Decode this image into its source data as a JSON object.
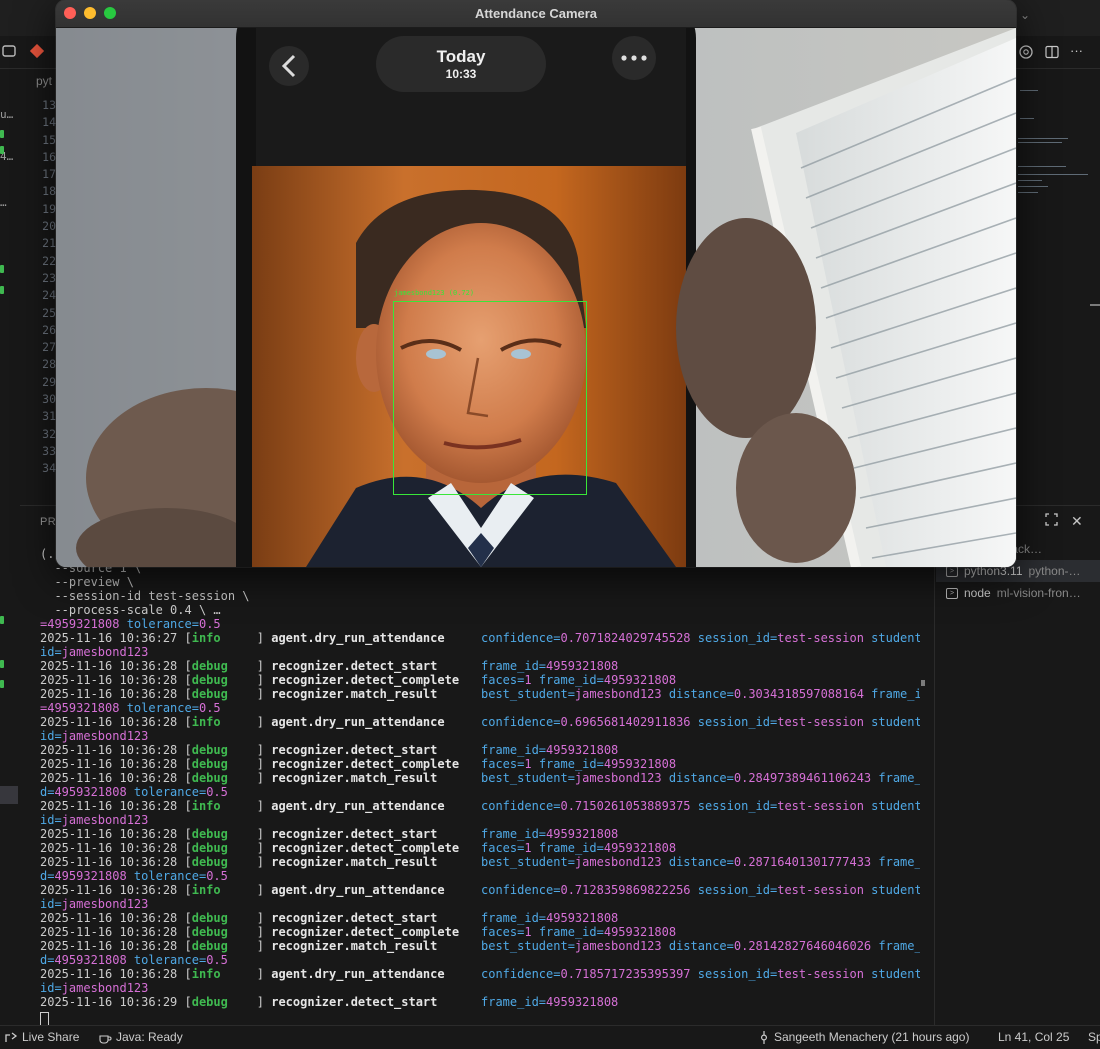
{
  "ide": {
    "editor_tab_label": "pyt",
    "line_numbers": [
      "13",
      "14",
      "15",
      "16",
      "17",
      "18",
      "19",
      "20",
      "21",
      "22",
      "23",
      "24",
      "25",
      "26",
      "27",
      "28",
      "29",
      "30",
      "31",
      "32",
      "33",
      "34"
    ],
    "panel_tab_label": "PR"
  },
  "camera_window": {
    "title": "Attendance Camera",
    "phone": {
      "header_title": "Today",
      "header_time": "10:33"
    },
    "detection": {
      "label": "jamesbond123 (0.72)",
      "box_color": "#39e639"
    }
  },
  "terminal": {
    "command_lines": [
      "(.",
      "  --source 1 \\",
      "  --preview \\",
      "  --session-id test-session \\",
      "  --process-scale 0.4 \\ …"
    ],
    "log_lines": [
      {
        "type": "wrap",
        "parts": [
          {
            "k": "",
            "v": "=4959321808"
          },
          {
            "k": " tolerance=",
            "v": "0.5"
          }
        ]
      },
      {
        "type": "log",
        "ts": "2025-11-16 10:36:27",
        "level": "info",
        "event": "agent.dry_run_attendance",
        "fields": [
          {
            "k": "confidence=",
            "v": "0.7071824029745528"
          },
          {
            "k": " session_id=",
            "v": "test-session"
          },
          {
            "k": " student_",
            "v": ""
          }
        ]
      },
      {
        "type": "wrap",
        "parts": [
          {
            "k": "id=",
            "v": "jamesbond123"
          }
        ]
      },
      {
        "type": "log",
        "ts": "2025-11-16 10:36:28",
        "level": "debug",
        "event": "recognizer.detect_start",
        "fields": [
          {
            "k": "frame_id=",
            "v": "4959321808"
          }
        ]
      },
      {
        "type": "log",
        "ts": "2025-11-16 10:36:28",
        "level": "debug",
        "event": "recognizer.detect_complete",
        "fields": [
          {
            "k": "faces=",
            "v": "1"
          },
          {
            "k": " frame_id=",
            "v": "4959321808"
          }
        ]
      },
      {
        "type": "log",
        "ts": "2025-11-16 10:36:28",
        "level": "debug",
        "event": "recognizer.match_result",
        "fields": [
          {
            "k": "best_student=",
            "v": "jamesbond123"
          },
          {
            "k": " distance=",
            "v": "0.3034318597088164"
          },
          {
            "k": " frame_id",
            "v": ""
          }
        ]
      },
      {
        "type": "wrap",
        "parts": [
          {
            "k": "",
            "v": "=4959321808"
          },
          {
            "k": " tolerance=",
            "v": "0.5"
          }
        ]
      },
      {
        "type": "log",
        "ts": "2025-11-16 10:36:28",
        "level": "info",
        "event": "agent.dry_run_attendance",
        "fields": [
          {
            "k": "confidence=",
            "v": "0.6965681402911836"
          },
          {
            "k": " session_id=",
            "v": "test-session"
          },
          {
            "k": " student_",
            "v": ""
          }
        ]
      },
      {
        "type": "wrap",
        "parts": [
          {
            "k": "id=",
            "v": "jamesbond123"
          }
        ]
      },
      {
        "type": "log",
        "ts": "2025-11-16 10:36:28",
        "level": "debug",
        "event": "recognizer.detect_start",
        "fields": [
          {
            "k": "frame_id=",
            "v": "4959321808"
          }
        ]
      },
      {
        "type": "log",
        "ts": "2025-11-16 10:36:28",
        "level": "debug",
        "event": "recognizer.detect_complete",
        "fields": [
          {
            "k": "faces=",
            "v": "1"
          },
          {
            "k": " frame_id=",
            "v": "4959321808"
          }
        ]
      },
      {
        "type": "log",
        "ts": "2025-11-16 10:36:28",
        "level": "debug",
        "event": "recognizer.match_result",
        "fields": [
          {
            "k": "best_student=",
            "v": "jamesbond123"
          },
          {
            "k": " distance=",
            "v": "0.28497389461106243"
          },
          {
            "k": " frame_i",
            "v": ""
          }
        ]
      },
      {
        "type": "wrap",
        "parts": [
          {
            "k": "d=",
            "v": "4959321808"
          },
          {
            "k": " tolerance=",
            "v": "0.5"
          }
        ]
      },
      {
        "type": "log",
        "ts": "2025-11-16 10:36:28",
        "level": "info",
        "event": "agent.dry_run_attendance",
        "fields": [
          {
            "k": "confidence=",
            "v": "0.7150261053889375"
          },
          {
            "k": " session_id=",
            "v": "test-session"
          },
          {
            "k": " student_",
            "v": ""
          }
        ]
      },
      {
        "type": "wrap",
        "parts": [
          {
            "k": "id=",
            "v": "jamesbond123"
          }
        ]
      },
      {
        "type": "log",
        "ts": "2025-11-16 10:36:28",
        "level": "debug",
        "event": "recognizer.detect_start",
        "fields": [
          {
            "k": "frame_id=",
            "v": "4959321808"
          }
        ]
      },
      {
        "type": "log",
        "ts": "2025-11-16 10:36:28",
        "level": "debug",
        "event": "recognizer.detect_complete",
        "fields": [
          {
            "k": "faces=",
            "v": "1"
          },
          {
            "k": " frame_id=",
            "v": "4959321808"
          }
        ]
      },
      {
        "type": "log",
        "ts": "2025-11-16 10:36:28",
        "level": "debug",
        "event": "recognizer.match_result",
        "fields": [
          {
            "k": "best_student=",
            "v": "jamesbond123"
          },
          {
            "k": " distance=",
            "v": "0.28716401301777433"
          },
          {
            "k": " frame_i",
            "v": ""
          }
        ]
      },
      {
        "type": "wrap",
        "parts": [
          {
            "k": "d=",
            "v": "4959321808"
          },
          {
            "k": " tolerance=",
            "v": "0.5"
          }
        ]
      },
      {
        "type": "log",
        "ts": "2025-11-16 10:36:28",
        "level": "info",
        "event": "agent.dry_run_attendance",
        "fields": [
          {
            "k": "confidence=",
            "v": "0.7128359869822256"
          },
          {
            "k": " session_id=",
            "v": "test-session"
          },
          {
            "k": " student_",
            "v": ""
          }
        ]
      },
      {
        "type": "wrap",
        "parts": [
          {
            "k": "id=",
            "v": "jamesbond123"
          }
        ]
      },
      {
        "type": "log",
        "ts": "2025-11-16 10:36:28",
        "level": "debug",
        "event": "recognizer.detect_start",
        "fields": [
          {
            "k": "frame_id=",
            "v": "4959321808"
          }
        ]
      },
      {
        "type": "log",
        "ts": "2025-11-16 10:36:28",
        "level": "debug",
        "event": "recognizer.detect_complete",
        "fields": [
          {
            "k": "faces=",
            "v": "1"
          },
          {
            "k": " frame_id=",
            "v": "4959321808"
          }
        ]
      },
      {
        "type": "log",
        "ts": "2025-11-16 10:36:28",
        "level": "debug",
        "event": "recognizer.match_result",
        "fields": [
          {
            "k": "best_student=",
            "v": "jamesbond123"
          },
          {
            "k": " distance=",
            "v": "0.28142827646046026"
          },
          {
            "k": " frame_i",
            "v": ""
          }
        ]
      },
      {
        "type": "wrap",
        "parts": [
          {
            "k": "d=",
            "v": "4959321808"
          },
          {
            "k": " tolerance=",
            "v": "0.5"
          }
        ]
      },
      {
        "type": "log",
        "ts": "2025-11-16 10:36:28",
        "level": "info",
        "event": "agent.dry_run_attendance",
        "fields": [
          {
            "k": "confidence=",
            "v": "0.7185717235395397"
          },
          {
            "k": " session_id=",
            "v": "test-session"
          },
          {
            "k": " student_",
            "v": ""
          }
        ]
      },
      {
        "type": "wrap",
        "parts": [
          {
            "k": "id=",
            "v": "jamesbond123"
          }
        ]
      },
      {
        "type": "log",
        "ts": "2025-11-16 10:36:29",
        "level": "debug",
        "event": "recognizer.detect_start",
        "fields": [
          {
            "k": "frame_id=",
            "v": "4959321808"
          }
        ]
      }
    ],
    "sessions": [
      {
        "name": "",
        "desc": "vision-back…",
        "selected": false
      },
      {
        "name": "python3.11",
        "desc": "python-…",
        "selected": true
      },
      {
        "name": "node",
        "desc": "ml-vision-fron…",
        "selected": false
      }
    ]
  },
  "status_bar": {
    "live_share": "Live Share",
    "java_status": "Java: Ready",
    "blame": "Sangeeth Menachery (21 hours ago)",
    "cursor_position": "Ln 41, Col 25",
    "truncated": "Sp"
  },
  "colors": {
    "log_green": "#3fb950",
    "key_blue": "#4fa9e6",
    "value_magenta": "#d670d6",
    "detection_green": "#39e639"
  }
}
